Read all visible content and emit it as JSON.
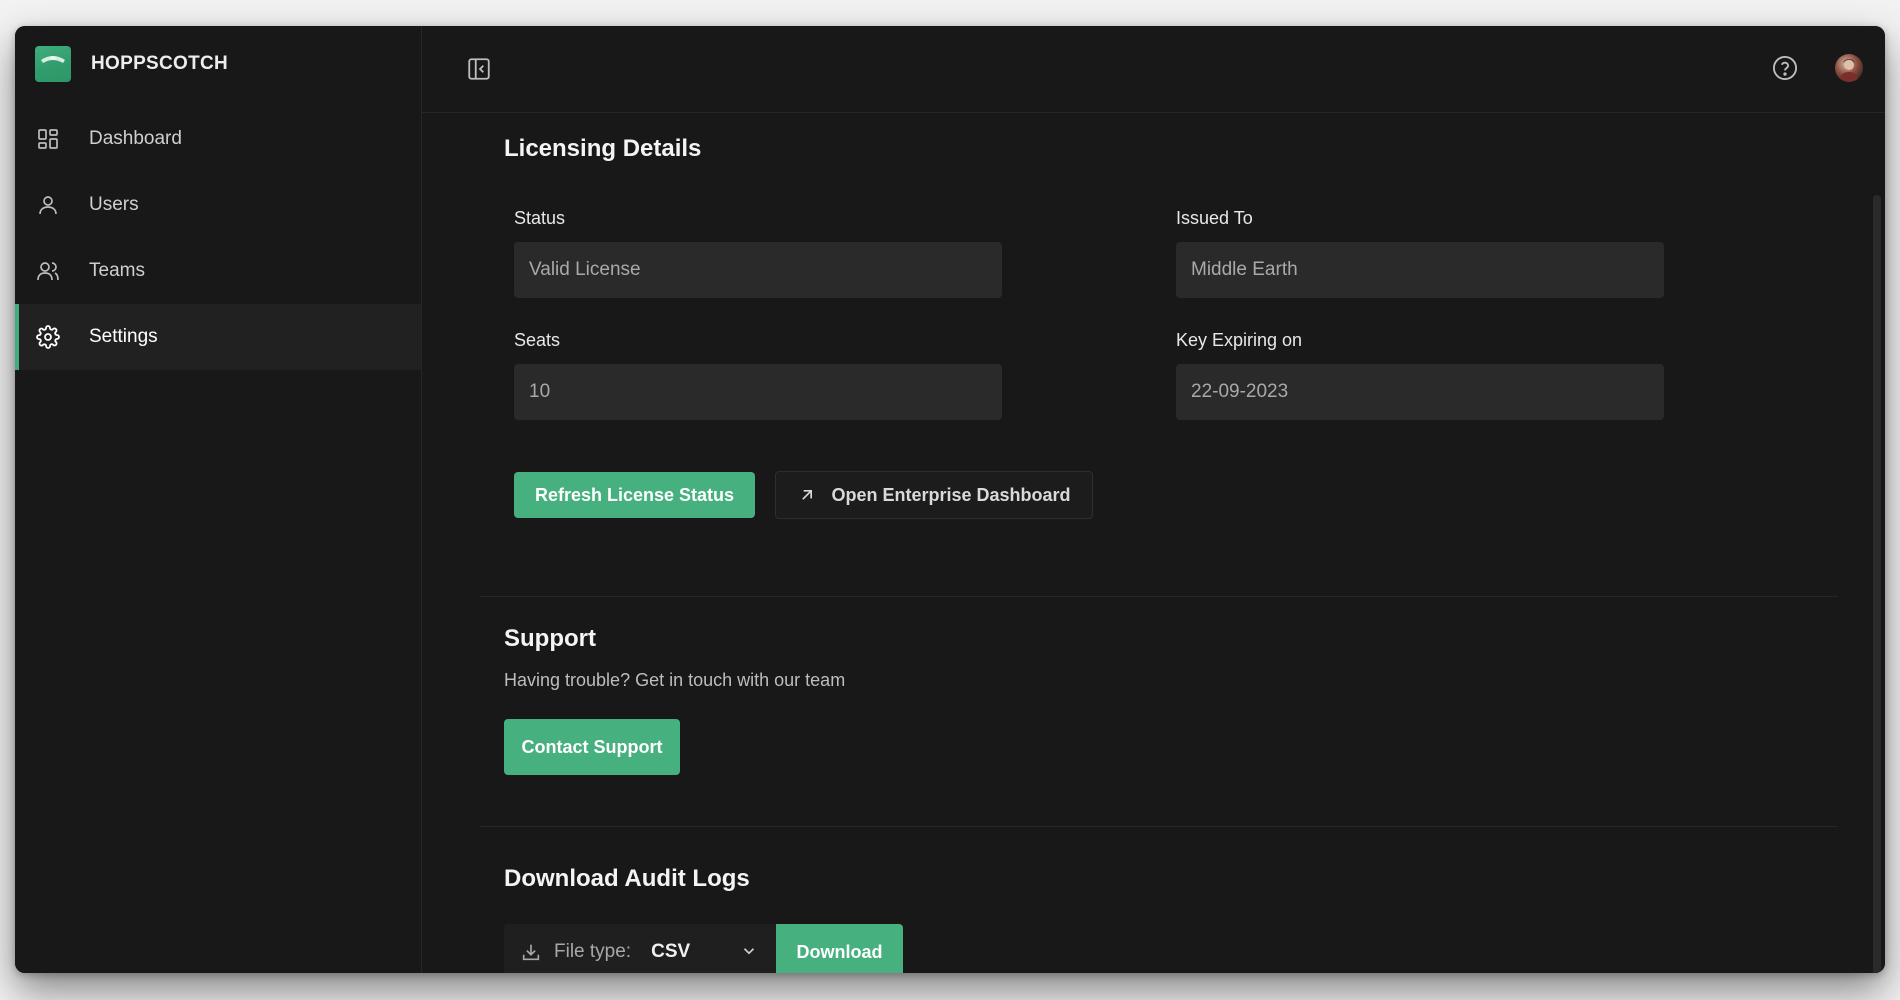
{
  "app": {
    "brand_name": "HOPPSCOTCH"
  },
  "sidebar": {
    "items": [
      {
        "label": "Dashboard",
        "icon": "dashboard-grid-icon",
        "active": false
      },
      {
        "label": "Users",
        "icon": "user-icon",
        "active": false
      },
      {
        "label": "Teams",
        "icon": "users-icon",
        "active": false
      },
      {
        "label": "Settings",
        "icon": "gear-icon",
        "active": true
      }
    ]
  },
  "topbar": {
    "collapse_icon": "sidebar-collapse-icon",
    "help_icon": "help-circle-icon",
    "avatar_icon": "user-avatar"
  },
  "licensing": {
    "title": "Licensing Details",
    "status_label": "Status",
    "status_value": "Valid License",
    "issued_to_label": "Issued To",
    "issued_to_value": "Middle Earth",
    "seats_label": "Seats",
    "seats_value": "10",
    "key_expiry_label": "Key Expiring on",
    "key_expiry_value": "22-09-2023",
    "refresh_button": "Refresh License Status",
    "open_dashboard_button": "Open Enterprise Dashboard"
  },
  "support": {
    "title": "Support",
    "description": "Having trouble? Get in touch with our team",
    "contact_button": "Contact Support"
  },
  "audit": {
    "title": "Download Audit Logs",
    "file_type_label": "File type:",
    "file_type_value": "CSV",
    "download_button": "Download"
  },
  "colors": {
    "accent": "#46b07f",
    "background": "#181818",
    "input_bg": "#2a2a2a"
  }
}
